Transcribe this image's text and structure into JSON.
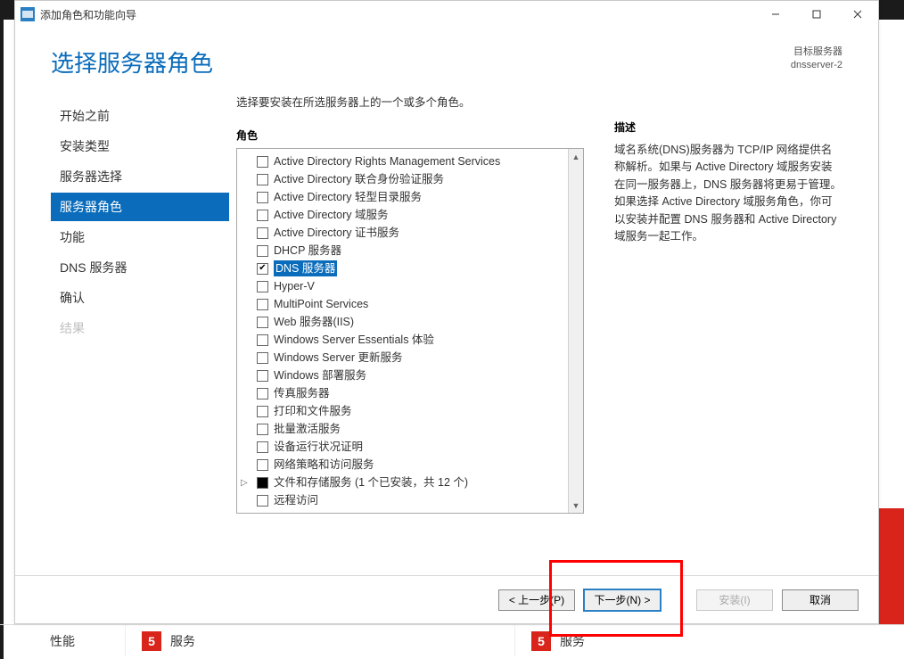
{
  "window": {
    "title": "添加角色和功能向导"
  },
  "header": {
    "page_title": "选择服务器角色",
    "target_label": "目标服务器",
    "target_value": "dnsserver-2"
  },
  "nav": {
    "items": [
      {
        "label": "开始之前",
        "state": "normal"
      },
      {
        "label": "安装类型",
        "state": "normal"
      },
      {
        "label": "服务器选择",
        "state": "normal"
      },
      {
        "label": "服务器角色",
        "state": "active"
      },
      {
        "label": "功能",
        "state": "normal"
      },
      {
        "label": "DNS 服务器",
        "state": "normal"
      },
      {
        "label": "确认",
        "state": "normal"
      },
      {
        "label": "结果",
        "state": "disabled"
      }
    ]
  },
  "main": {
    "instruction": "选择要安装在所选服务器上的一个或多个角色。",
    "roles_header": "角色",
    "roles": [
      {
        "label": "Active Directory Rights Management Services",
        "checked": false,
        "selected": false
      },
      {
        "label": "Active Directory 联合身份验证服务",
        "checked": false,
        "selected": false
      },
      {
        "label": "Active Directory 轻型目录服务",
        "checked": false,
        "selected": false
      },
      {
        "label": "Active Directory 域服务",
        "checked": false,
        "selected": false
      },
      {
        "label": "Active Directory 证书服务",
        "checked": false,
        "selected": false
      },
      {
        "label": "DHCP 服务器",
        "checked": false,
        "selected": false
      },
      {
        "label": "DNS 服务器",
        "checked": true,
        "selected": true
      },
      {
        "label": "Hyper-V",
        "checked": false,
        "selected": false
      },
      {
        "label": "MultiPoint Services",
        "checked": false,
        "selected": false
      },
      {
        "label": "Web 服务器(IIS)",
        "checked": false,
        "selected": false
      },
      {
        "label": "Windows Server Essentials 体验",
        "checked": false,
        "selected": false
      },
      {
        "label": "Windows Server 更新服务",
        "checked": false,
        "selected": false
      },
      {
        "label": "Windows 部署服务",
        "checked": false,
        "selected": false
      },
      {
        "label": "传真服务器",
        "checked": false,
        "selected": false
      },
      {
        "label": "打印和文件服务",
        "checked": false,
        "selected": false
      },
      {
        "label": "批量激活服务",
        "checked": false,
        "selected": false
      },
      {
        "label": "设备运行状况证明",
        "checked": false,
        "selected": false
      },
      {
        "label": "网络策略和访问服务",
        "checked": false,
        "selected": false
      },
      {
        "label": "文件和存储服务 (1 个已安装，共 12 个)",
        "checked": "partial",
        "selected": false,
        "expandable": true
      },
      {
        "label": "远程访问",
        "checked": false,
        "selected": false
      }
    ]
  },
  "description": {
    "header": "描述",
    "text": "域名系统(DNS)服务器为 TCP/IP 网络提供名称解析。如果与 Active Directory 域服务安装在同一服务器上，DNS 服务器将更易于管理。如果选择 Active Directory 域服务角色，你可以安装并配置 DNS 服务器和 Active Directory 域服务一起工作。"
  },
  "footer": {
    "prev": "< 上一步(P)",
    "next": "下一步(N) >",
    "install": "安装(I)",
    "cancel": "取消"
  },
  "backdrop": {
    "perf_label": "性能",
    "service_label": "服务",
    "badge_left": "5",
    "badge_right": "5"
  }
}
